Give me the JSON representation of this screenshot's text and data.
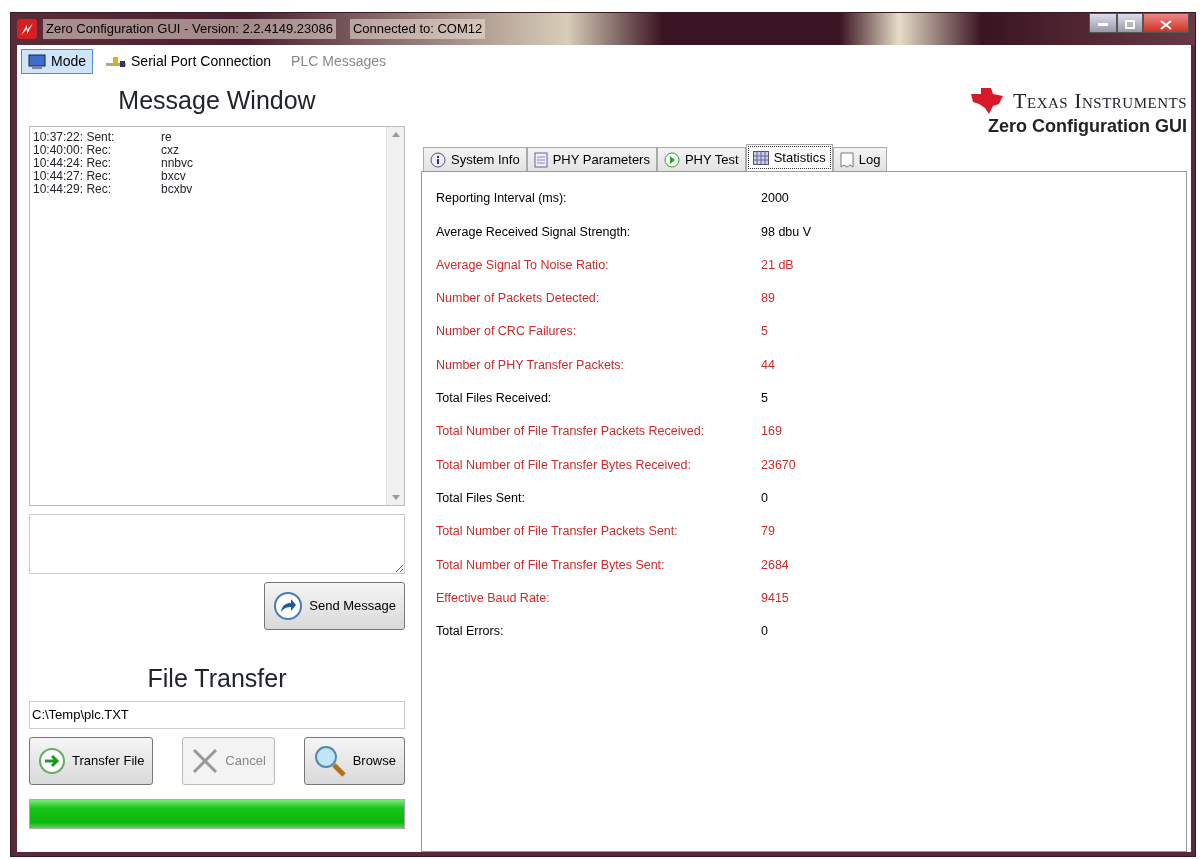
{
  "window": {
    "title": "Zero Configuration GUI - Version: 2.2.4149.23086",
    "connection": "Connected to: COM12"
  },
  "menu": [
    {
      "label": "Mode",
      "selected": true,
      "disabled": false,
      "kind": "monitor"
    },
    {
      "label": "Serial Port Connection",
      "selected": false,
      "disabled": false,
      "kind": "plug"
    },
    {
      "label": "PLC Messages",
      "selected": false,
      "disabled": true,
      "kind": "none"
    }
  ],
  "message_window": {
    "title": "Message Window",
    "messages": [
      {
        "time": "10:37:22: Sent:",
        "text": "re"
      },
      {
        "time": "10:40:00: Rec:",
        "text": "cxz"
      },
      {
        "time": "10:44:24: Rec:",
        "text": "nnbvc"
      },
      {
        "time": "10:44:27: Rec:",
        "text": "bxcv"
      },
      {
        "time": "10:44:29: Rec:",
        "text": "bcxbv"
      }
    ],
    "send_button": "Send Message"
  },
  "file_transfer": {
    "title": "File Transfer",
    "path": "C:\\Temp\\plc.TXT",
    "buttons": [
      {
        "label": "Transfer File",
        "kind": "transfer",
        "disabled": false
      },
      {
        "label": "Cancel",
        "kind": "cancel",
        "disabled": true
      },
      {
        "label": "Browse",
        "kind": "browse",
        "disabled": false
      }
    ],
    "progress": {
      "level": 1.0
    }
  },
  "logo": {
    "company": "Texas Instruments",
    "subtitle": "Zero Configuration GUI"
  },
  "tabs": [
    {
      "label": "System Info",
      "kind": "info",
      "selected": false
    },
    {
      "label": "PHY Parameters",
      "kind": "doc",
      "selected": false
    },
    {
      "label": "PHY Test",
      "kind": "play",
      "selected": false
    },
    {
      "label": "Statistics",
      "kind": "grid",
      "selected": true
    },
    {
      "label": "Log",
      "kind": "page",
      "selected": false
    }
  ],
  "statistics": [
    {
      "label": "Reporting Interval (ms):",
      "value": "2000",
      "color": "#000000"
    },
    {
      "label": "Average Received Signal Strength:",
      "value": "98 dbu V",
      "color": "#000000"
    },
    {
      "label": "Average Signal To Noise Ratio:",
      "value": "21 dB",
      "color": "#cc2b2b"
    },
    {
      "label": "Number of Packets Detected:",
      "value": "89",
      "color": "#cc2b2b"
    },
    {
      "label": "Number of CRC Failures:",
      "value": "5",
      "color": "#cc2b2b"
    },
    {
      "label": "Number of PHY Transfer Packets:",
      "value": "44",
      "color": "#cc2b2b"
    },
    {
      "label": "Total Files Received:",
      "value": "5",
      "color": "#000000"
    },
    {
      "label": "Total Number of File Transfer Packets Received:",
      "value": "169",
      "color": "#cc2b2b"
    },
    {
      "label": "Total Number of File Transfer Bytes Received:",
      "value": "23670",
      "color": "#cc2b2b"
    },
    {
      "label": "Total Files Sent:",
      "value": "0",
      "color": "#000000"
    },
    {
      "label": "Total Number of File Transfer Packets Sent:",
      "value": "79",
      "color": "#cc2b2b"
    },
    {
      "label": "Total Number of File Transfer Bytes Sent:",
      "value": "2684",
      "color": "#cc2b2b"
    },
    {
      "label": "Effective Baud Rate:",
      "value": "9415",
      "color": "#cc2b2b"
    },
    {
      "label": "Total Errors:",
      "value": "0",
      "color": "#000000"
    }
  ]
}
